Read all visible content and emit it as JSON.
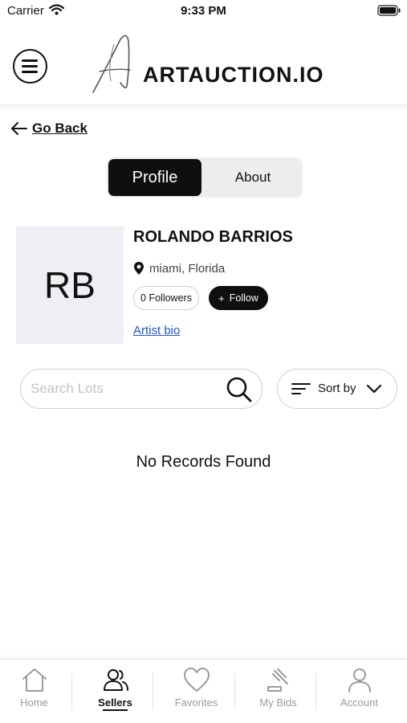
{
  "status_bar": {
    "carrier": "Carrier",
    "time": "9:33 PM"
  },
  "header": {
    "logo_text": "ARTAUCTION.IO",
    "menu_icon": "hamburger-menu-icon"
  },
  "navigation": {
    "go_back_label": "Go Back"
  },
  "profile_tabs": {
    "profile_label": "Profile",
    "about_label": "About",
    "active": "Profile"
  },
  "seller": {
    "initials": "RB",
    "name": "ROLANDO BARRIOS",
    "location": "miami, Florida",
    "followers_label": "0 Followers",
    "follow_label": "Follow",
    "follow_icon": "+",
    "bio_link": "Artist bio"
  },
  "search": {
    "placeholder": "Search Lots",
    "value": ""
  },
  "sort": {
    "label": "Sort by"
  },
  "lots": {
    "empty_message": "No Records Found"
  },
  "tabbar": {
    "items": [
      {
        "label": "Home",
        "icon": "home-icon"
      },
      {
        "label": "Sellers",
        "icon": "users-icon"
      },
      {
        "label": "Favorites",
        "icon": "heart-icon"
      },
      {
        "label": "My Bids",
        "icon": "gavel-icon"
      },
      {
        "label": "Account",
        "icon": "user-icon"
      }
    ],
    "active": "Sellers"
  },
  "colors": {
    "primary": "#0f0f0f",
    "link": "#2255cc",
    "inactive": "#9a9a9a",
    "placeholder": "#c2c2c2"
  }
}
